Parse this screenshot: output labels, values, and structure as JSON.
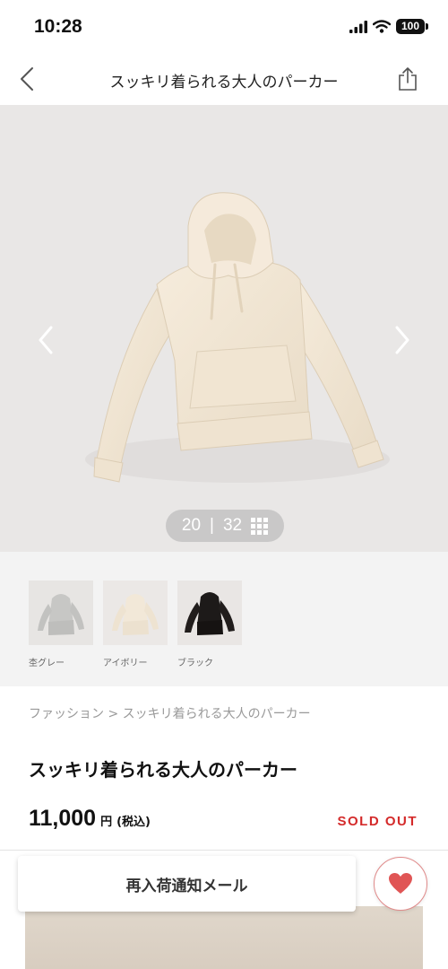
{
  "status_bar": {
    "time": "10:28",
    "battery": "100"
  },
  "nav": {
    "title": "スッキリ着られる大人のパーカー",
    "back_icon": "chevron-left-icon",
    "share_icon": "share-icon"
  },
  "carousel": {
    "current": "20",
    "separator": "|",
    "total": "32",
    "grid_icon": "grid-icon"
  },
  "swatches": [
    {
      "label": "杢グレー",
      "color": "#c7c7c5"
    },
    {
      "label": "アイボリー",
      "color": "#efe6d6"
    },
    {
      "label": "ブラック",
      "color": "#1d1a19"
    }
  ],
  "product": {
    "breadcrumb": "ファッション > スッキリ着られる大人のパーカー",
    "title": "スッキリ着られる大人のパーカー",
    "price": "11,000",
    "price_unit": "円",
    "price_tax": "(税込)",
    "status": "SOLD OUT"
  },
  "actions": {
    "restock_label": "再入荷通知メール",
    "favorite_icon": "heart-icon"
  },
  "colors": {
    "accent_red": "#d42a2a",
    "heart": "#e05555"
  }
}
